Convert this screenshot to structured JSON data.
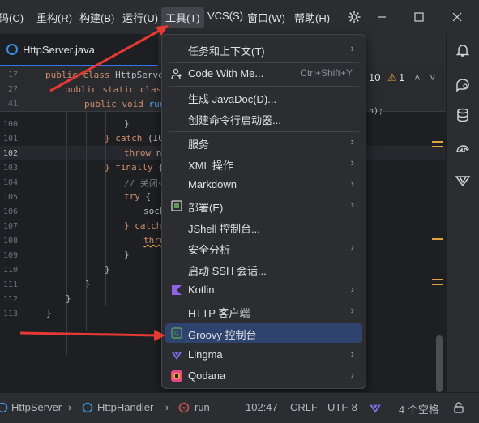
{
  "menubar": {
    "items": [
      "码(C)",
      "重构(R)",
      "构建(B)",
      "运行(U)",
      "工具(T)",
      "VCS(S)",
      "窗口(W)",
      "帮助(H)"
    ]
  },
  "tab": {
    "label": "HttpServer.java"
  },
  "editor": {
    "sticky_lines": [
      {
        "num": "17",
        "kw": "public class ",
        "id": "HttpServer"
      },
      {
        "num": "27",
        "kw": "public static class",
        "id": ""
      },
      {
        "num": "41",
        "kw": "public void ",
        "fn": "run"
      }
    ],
    "line_numbers": [
      "100",
      "101",
      "102",
      "103",
      "104",
      "105",
      "106",
      "107",
      "108",
      "109",
      "110",
      "111",
      "112",
      "113"
    ],
    "code_lines": [
      {
        "text": "}",
        "cls": "id"
      },
      {
        "kw": "} catch ",
        "id": "(IO"
      },
      {
        "kw": "throw ",
        "id": "n"
      },
      {
        "kw": "} finally ",
        "id": "{"
      },
      {
        "cm": "// 关闭s"
      },
      {
        "kw": "try ",
        "id": "{"
      },
      {
        "id": "sock"
      },
      {
        "kw": "} catch",
        "id": ""
      },
      {
        "kw": "thro",
        "id": ""
      },
      {
        "text": "}",
        "cls": "id"
      },
      {
        "text": "}",
        "cls": "id"
      },
      {
        "text": "}",
        "cls": "id"
      },
      {
        "text": "}",
        "cls": "id"
      },
      {
        "text": "}",
        "cls": "id"
      }
    ],
    "inspection_count": "10",
    "warning_count": "1",
    "truncated_tail": "n);"
  },
  "dropdown": {
    "items": [
      {
        "label": "任务和上下文(T)",
        "arrow": "›"
      },
      {
        "label": "Code With Me...",
        "shortcut": "Ctrl+Shift+Y",
        "icon": "person-icon"
      },
      {
        "label": "生成 JavaDoc(D)..."
      },
      {
        "label": "创建命令行启动器..."
      },
      {
        "label": "服务",
        "arrow": "›"
      },
      {
        "label": "XML 操作",
        "arrow": "›"
      },
      {
        "label": "Markdown",
        "arrow": "›"
      },
      {
        "label": "部署(E)",
        "arrow": "›",
        "icon": "deploy-icon"
      },
      {
        "label": "JShell 控制台..."
      },
      {
        "label": "安全分析",
        "arrow": "›"
      },
      {
        "label": "启动 SSH 会话..."
      },
      {
        "label": "Kotlin",
        "arrow": "›",
        "icon": "kotlin-icon"
      },
      {
        "label": "HTTP 客户端",
        "arrow": "›"
      },
      {
        "label": "Groovy 控制台",
        "icon": "groovy-icon",
        "selected": true
      },
      {
        "label": "Lingma",
        "arrow": "›",
        "icon": "lingma-icon"
      },
      {
        "label": "Qodana",
        "arrow": "›",
        "icon": "qodana-icon"
      }
    ]
  },
  "statusbar": {
    "crumb1": "HttpServer",
    "crumb2": "HttpHandler",
    "crumb3": "run",
    "position": "102:47",
    "line_sep": "CRLF",
    "encoding": "UTF-8",
    "indent": "4 个空格"
  },
  "colors": {
    "accent": "#3574f0",
    "selection": "#2e436e",
    "arrow": "#e53935",
    "warning": "#e0a43c"
  }
}
